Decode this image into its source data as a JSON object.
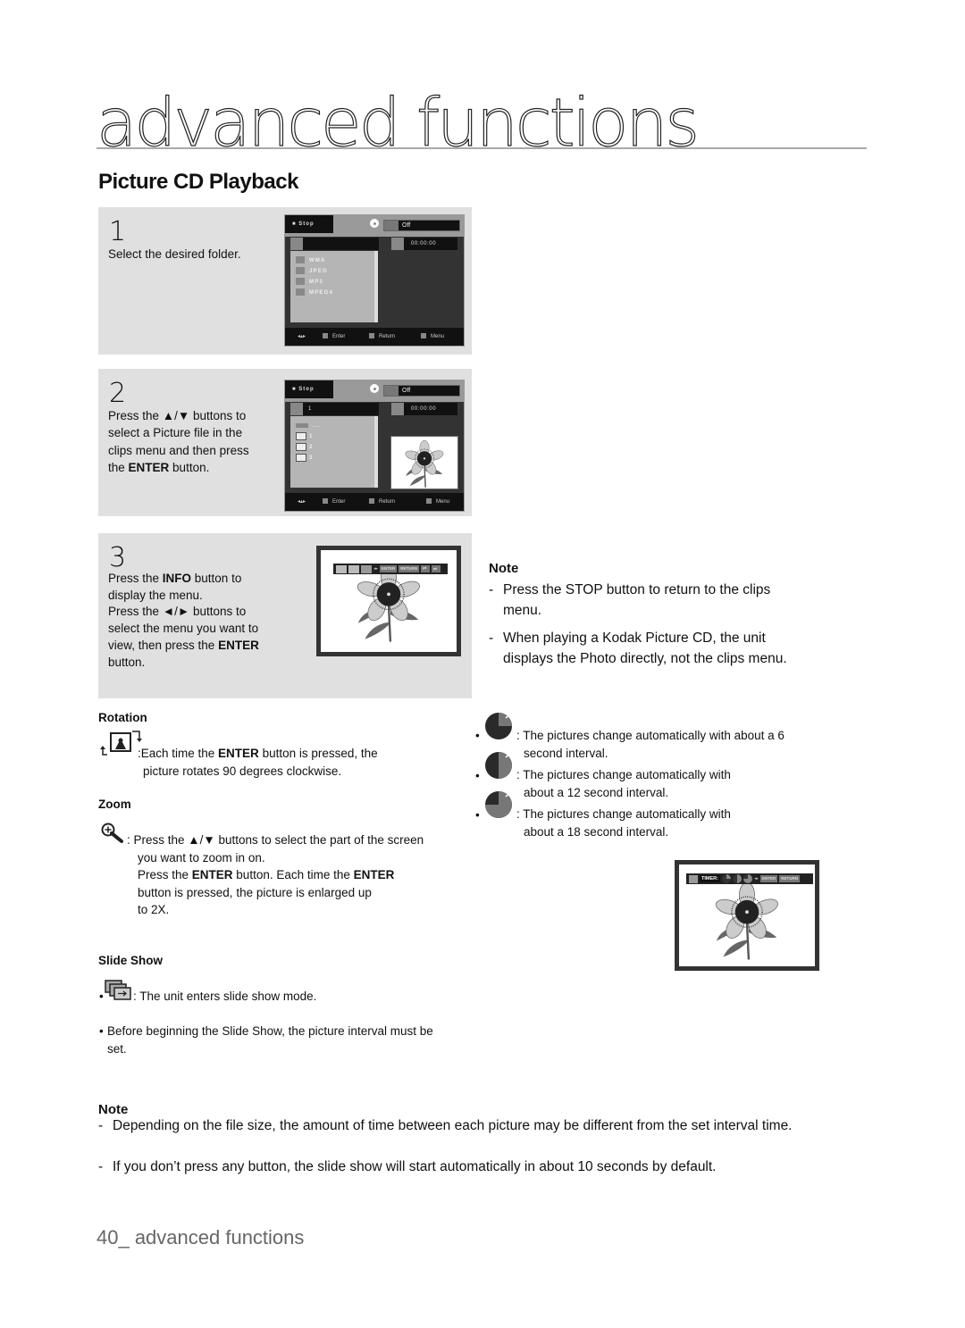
{
  "header": {
    "chapter_title": "advanced functions",
    "section_title": "Picture CD Playback"
  },
  "steps": [
    {
      "number": "1",
      "text": "Select the desired folder.",
      "screen": {
        "status": "Stop",
        "repeat": "Off",
        "track": "",
        "time": "00:00:00",
        "items": [
          "WMA",
          "JPEG",
          "MP3",
          "MPEG4"
        ],
        "footer": {
          "enter": "Enter",
          "return": "Return",
          "menu": "Menu"
        }
      }
    },
    {
      "number": "2",
      "text_parts": [
        "Press the ▲/▼ buttons to select a Picture file in the clips menu and then press the ",
        "ENTER",
        " button."
      ],
      "screen": {
        "status": "Stop",
        "repeat": "Off",
        "track": "1",
        "time": "00:00:00",
        "items": [
          "...",
          "1",
          "2",
          "3"
        ],
        "footer": {
          "enter": "Enter",
          "return": "Return",
          "menu": "Menu"
        }
      }
    },
    {
      "number": "3",
      "text_parts": [
        "Press the ",
        "INFO",
        " button to display the menu.",
        "Press the ◄/► buttons to select the menu you want to view, then press the ",
        "ENTER",
        " button."
      ],
      "screen": {
        "menu_buttons": [
          "ENTER",
          "RETURN"
        ]
      }
    }
  ],
  "note_right": {
    "heading": "Note",
    "items": [
      "Press the STOP button to return to the clips menu.",
      "When playing a Kodak Picture CD, the unit displays the Photo directly, not the clips menu."
    ]
  },
  "rotation": {
    "heading": "Rotation",
    "text_parts": [
      ":Each time the ",
      "ENTER",
      " button is pressed, the",
      "picture rotates 90 degrees clockwise."
    ]
  },
  "zoom": {
    "heading": "Zoom",
    "line1": ": Press the ▲/▼ buttons to select the part of the screen",
    "line2": "you want to zoom in on.",
    "line3_parts": [
      "Press the ",
      "ENTER",
      " button. Each time the ",
      "ENTER"
    ],
    "line4": "button is pressed, the picture is enlarged up",
    "line5": "to 2X."
  },
  "slideshow": {
    "heading": "Slide Show",
    "bullet1": ": The unit enters slide show mode.",
    "bullet2_line1": "Before beginning the Slide Show, the picture interval must be",
    "bullet2_line2": "set."
  },
  "timer_items": [
    {
      "line1": ": The pictures change automatically with about a 6",
      "line2": "second interval.",
      "interval_seconds": 6
    },
    {
      "line1": ": The pictures change automatically with",
      "line2": "about a 12 second interval.",
      "interval_seconds": 12
    },
    {
      "line1": ": The pictures change automatically with",
      "line2": "about a 18 second interval.",
      "interval_seconds": 18
    }
  ],
  "timer_screen": {
    "label": "TIMER:",
    "buttons": [
      "ENTER",
      "RETURN"
    ]
  },
  "note_bottom": {
    "heading": "Note",
    "items": [
      "Depending on the file size, the amount of time between each picture may be different from the set interval time.",
      "If you don’t press any button, the slide show will start automatically in about 10 seconds by default."
    ]
  },
  "footer": {
    "page_label": "40_ advanced functions"
  }
}
